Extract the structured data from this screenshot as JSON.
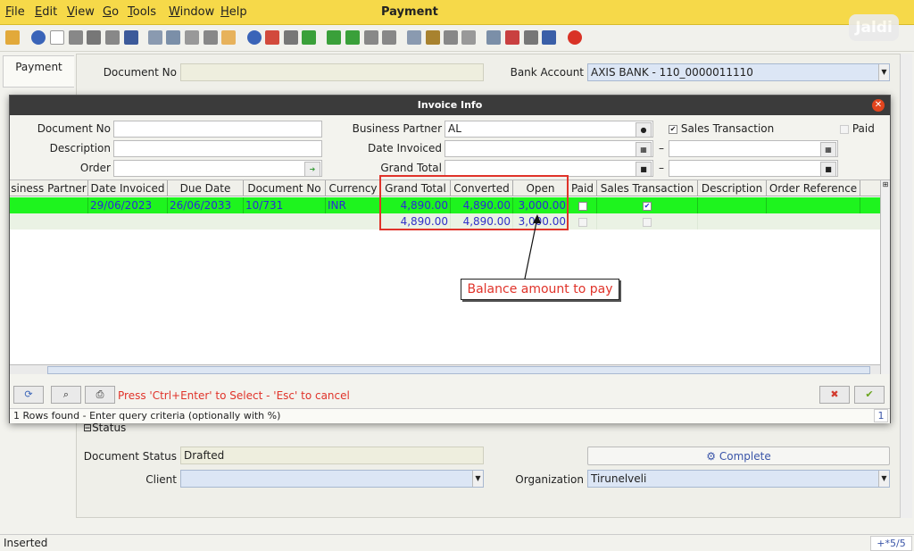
{
  "menu": {
    "items": [
      "File",
      "Edit",
      "View",
      "Go",
      "Tools",
      "Window",
      "Help"
    ]
  },
  "window_title": "Payment",
  "logo_text": "Jaldi",
  "background": {
    "tab_label": "Payment",
    "document_no_label": "Document No",
    "document_no_value": "",
    "bank_account_label": "Bank Account",
    "bank_account_value": "AXIS BANK - 110_0000011110",
    "status_section": "Status",
    "document_status_label": "Document Status",
    "document_status_value": "Drafted",
    "client_label": "Client",
    "organization_label": "Organization",
    "organization_value": "Tirunelveli",
    "complete_button": "Complete"
  },
  "statusbar": {
    "left": "Inserted",
    "right": "+*5/5"
  },
  "dialog": {
    "title": "Invoice Info",
    "filters": {
      "document_no_label": "Document No",
      "description_label": "Description",
      "order_label": "Order",
      "business_partner_label": "Business Partner",
      "business_partner_value": "AL",
      "date_invoiced_label": "Date Invoiced",
      "grand_total_label": "Grand Total",
      "sales_transaction_label": "Sales Transaction",
      "paid_label": "Paid",
      "range_dash": "–"
    },
    "table": {
      "columns": [
        "siness Partner",
        "Date Invoiced",
        "Due Date",
        "Document No",
        "Currency",
        "Grand Total",
        "Converted",
        "Open",
        "Paid",
        "Sales Transaction",
        "Description",
        "Order Reference"
      ],
      "rows": [
        {
          "business_partner": "",
          "date_invoiced": "29/06/2023",
          "due_date": "26/06/2033",
          "document_no": "10/731",
          "currency": "INR",
          "grand_total": "4,890.00",
          "converted": "4,890.00",
          "open": "3,000.00",
          "paid": false,
          "sales_transaction": true,
          "description": "",
          "order_reference": ""
        }
      ],
      "totals": {
        "grand_total": "4,890.00",
        "converted": "4,890.00",
        "open": "3,000.00"
      }
    },
    "hint": "Press 'Ctrl+Enter' to Select - 'Esc' to cancel",
    "status_text": "1 Rows found - Enter query criteria (optionally with %)",
    "status_count": "1"
  },
  "annotation": {
    "callout": "Balance amount to pay"
  },
  "colors": {
    "menubar": "#f6d949",
    "selected_row": "#1ef41e",
    "annotation_red": "#e0332a",
    "value_blue": "#2b2bd6"
  }
}
